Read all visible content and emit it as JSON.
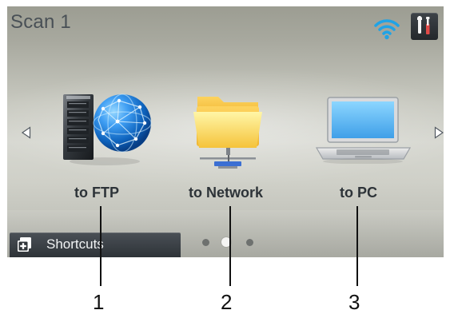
{
  "screen": {
    "title": "Scan 1"
  },
  "header": {
    "wifi_icon": "wifi-icon",
    "settings_icon": "tools-icon"
  },
  "navigation": {
    "left_icon": "left-arrow-icon",
    "right_icon": "right-arrow-icon"
  },
  "items": [
    {
      "label": "to FTP",
      "icon": "ftp-server-globe-icon",
      "callout": "1"
    },
    {
      "label": "to Network",
      "icon": "network-folder-icon",
      "callout": "2"
    },
    {
      "label": "to PC",
      "icon": "laptop-icon",
      "callout": "3"
    }
  ],
  "footer": {
    "shortcuts_label": "Shortcuts",
    "shortcuts_icon": "shortcuts-plus-icon",
    "page_count": 3,
    "active_page": 2
  },
  "colors": {
    "wifi": "#1fa3e6",
    "settings_bg": "#2b2f33",
    "shortcuts_bg": "#353a3f",
    "label_text": "#2d3338",
    "title_text": "#495056"
  }
}
